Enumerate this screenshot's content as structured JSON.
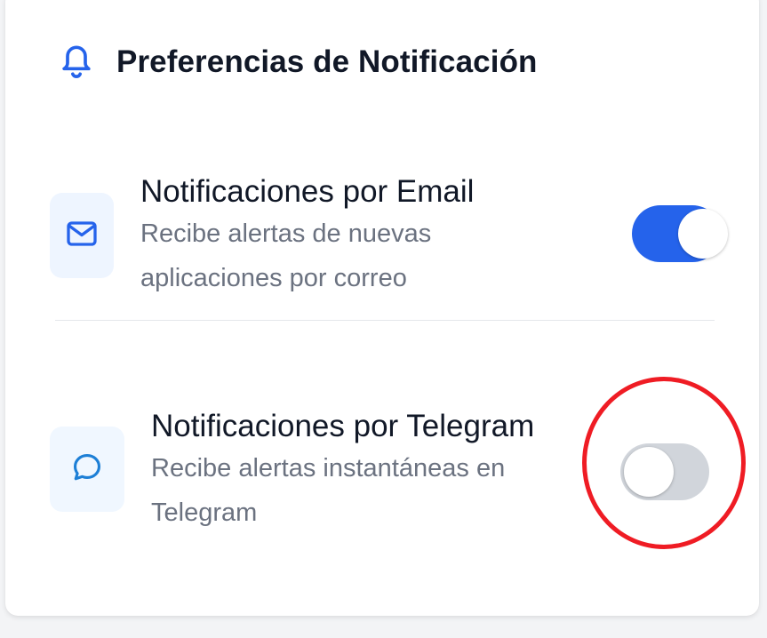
{
  "header": {
    "title": "Preferencias de Notificación",
    "icon": "bell-icon"
  },
  "colors": {
    "accent": "#2563eb",
    "toggle_off": "#d1d5db",
    "annotation": "#ef1c24"
  },
  "settings": [
    {
      "icon": "mail-icon",
      "title": "Notificaciones por Email",
      "description": "Recibe alertas de nuevas aplicaciones por correo",
      "enabled": true
    },
    {
      "icon": "chat-bubble-icon",
      "title": "Notificaciones por Telegram",
      "description": "Recibe alertas instantáneas en Telegram",
      "enabled": false
    }
  ]
}
